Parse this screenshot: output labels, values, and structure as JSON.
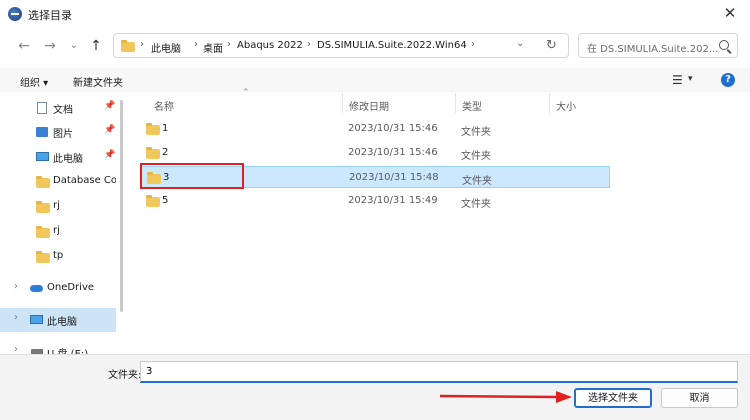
{
  "window": {
    "title": "选择目录",
    "close_glyph": "✕"
  },
  "nav": {
    "back": "←",
    "forward": "→",
    "recent": "⌄",
    "up": "↑",
    "breadcrumb": [
      "此电脑",
      "桌面",
      "Abaqus 2022",
      "DS.SIMULIA.Suite.2022.Win64"
    ],
    "separator": "›",
    "dropdown": "⌄",
    "refresh": "↻"
  },
  "search": {
    "placeholder": "在 DS.SIMULIA.Suite.202..."
  },
  "toolbar": {
    "organize": "组织 ▾",
    "new_folder": "新建文件夹",
    "view": "☰",
    "view_drop": "▾",
    "help": "?"
  },
  "sidebar": {
    "items": [
      {
        "label": "文档",
        "icon": "document-icon",
        "pinned": true
      },
      {
        "label": "图片",
        "icon": "picture-icon",
        "pinned": true
      },
      {
        "label": "此电脑",
        "icon": "computer-icon",
        "pinned": true
      },
      {
        "label": "Database Cor",
        "icon": "folder-icon"
      },
      {
        "label": "rj",
        "icon": "folder-icon"
      },
      {
        "label": "rj",
        "icon": "folder-icon"
      },
      {
        "label": "tp",
        "icon": "folder-icon"
      },
      {
        "label": "OneDrive",
        "icon": "cloud-icon"
      },
      {
        "label": "此电脑",
        "icon": "computer-icon"
      },
      {
        "label": "U 盘 (E:)",
        "icon": "drive-icon"
      }
    ],
    "pin_glyph": "📌",
    "chevron": "›"
  },
  "columns": {
    "name": "名称",
    "modified": "修改日期",
    "type": "类型",
    "size": "大小",
    "sort_glyph": "⌃"
  },
  "files": [
    {
      "name": "1",
      "modified": "2023/10/31 15:46",
      "type": "文件夹"
    },
    {
      "name": "2",
      "modified": "2023/10/31 15:46",
      "type": "文件夹"
    },
    {
      "name": "3",
      "modified": "2023/10/31 15:48",
      "type": "文件夹",
      "selected": true
    },
    {
      "name": "5",
      "modified": "2023/10/31 15:49",
      "type": "文件夹"
    }
  ],
  "footer": {
    "folder_label": "文件夹:",
    "folder_value": "3",
    "select_button": "选择文件夹",
    "cancel_button": "取消"
  },
  "colors": {
    "accent": "#1e6fd0",
    "highlight": "#e02020",
    "selection": "#cce8ff"
  }
}
